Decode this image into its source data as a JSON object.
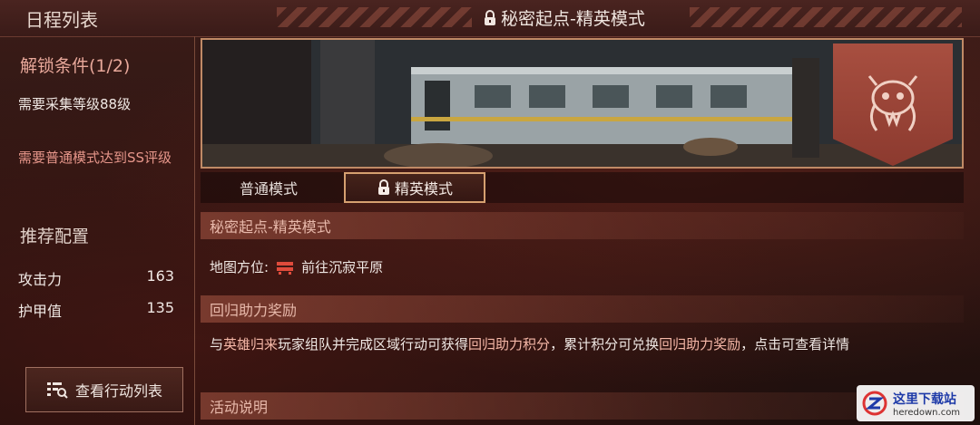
{
  "header": {
    "schedule_title": "日程列表",
    "mode_title": "秘密起点-精英模式"
  },
  "left": {
    "unlock_title": "解锁条件(1/2)",
    "requirements": [
      "需要采集等级88级",
      "需要普通模式达到SS评级"
    ],
    "recommend_title": "推荐配置",
    "stats": [
      {
        "label": "攻击力",
        "value": "163"
      },
      {
        "label": "护甲值",
        "value": "135"
      }
    ],
    "view_actions_label": "查看行动列表"
  },
  "tabs": {
    "normal": "普通模式",
    "elite": "精英模式",
    "selected": "elite"
  },
  "sections": {
    "name_title": "秘密起点-精英模式",
    "map_label": "地图方位:",
    "map_value": "前往沉寂平原",
    "reward_title": "回归助力奖励",
    "reward_desc": {
      "p1": "与",
      "h1": "英雄归来",
      "p2": "玩家组队并完成区域行动可获得",
      "h2": "回归助力积分",
      "p3": "，累计积分可兑换",
      "h3": "回归助力奖励",
      "p4": "，点击可查看详情"
    },
    "activity_title": "活动说明"
  },
  "icons": {
    "lock": "lock-icon",
    "boss": "boss-skull-icon",
    "map": "map-marker-icon",
    "list": "list-search-icon"
  },
  "watermark": {
    "cn": "这里下载站",
    "en": "heredown.com"
  },
  "colors": {
    "accent_border": "#c08a66",
    "highlight_text": "#f6b8a8",
    "unlock_title": "#e8a89a"
  }
}
